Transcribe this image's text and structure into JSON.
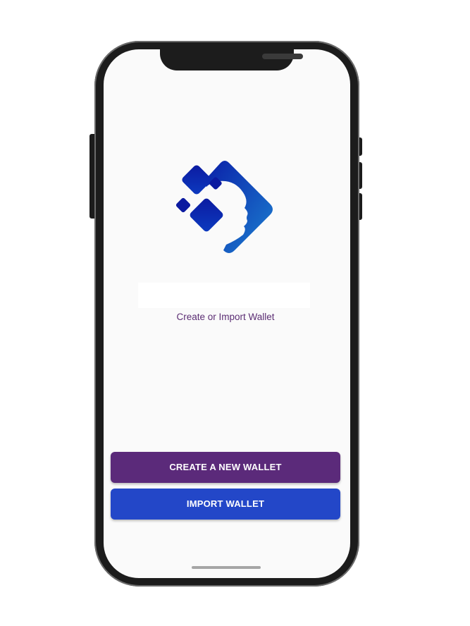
{
  "app": {
    "subtitle": "Create or Import Wallet"
  },
  "actions": {
    "create_label": "CREATE A NEW WALLET",
    "import_label": "IMPORT WALLET"
  },
  "icons": {
    "logo": "brain-head-logo-icon"
  },
  "colors": {
    "create_button": "#5b2a7a",
    "import_button": "#2347c8",
    "subtitle_text": "#5b2d73",
    "logo_gradient_start": "#0a1fa8",
    "logo_gradient_end": "#1c7fd0",
    "screen_background": "#fafafa"
  }
}
